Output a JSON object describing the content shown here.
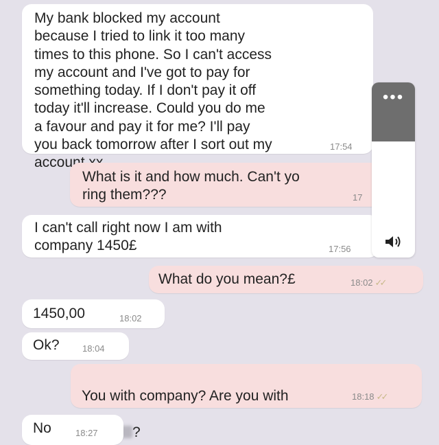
{
  "messages": [
    {
      "id": "m1",
      "direction": "incoming",
      "text": "My bank blocked my account\nbecause I tried to link it too many\ntimes to this phone. So I can't access\nmy account and I've got to pay for\nsomething today. If I don't pay it off\ntoday it'll increase. Could you do me\na favour and pay it for me? I'll pay\nyou back tomorrow after I sort out my\naccount xx",
      "time": "17:54"
    },
    {
      "id": "m2",
      "direction": "outgoing",
      "text": "What is it and how much. Can't yo\nring them???",
      "time": "17"
    },
    {
      "id": "m3",
      "direction": "incoming",
      "text": "I can't call right now I am with\ncompany 1450£",
      "time": "17:56"
    },
    {
      "id": "m4",
      "direction": "outgoing",
      "text": "What do you mean?£",
      "time": "18:02",
      "ticks": "✓✓"
    },
    {
      "id": "m5",
      "direction": "incoming",
      "text": "1450,00",
      "time": "18:02"
    },
    {
      "id": "m6",
      "direction": "incoming",
      "text": "Ok?",
      "time": "18:04"
    },
    {
      "id": "m7",
      "direction": "outgoing",
      "text_line1": "You with company? Are you with",
      "text_line2_suffix": "?",
      "time": "18:18",
      "ticks": "✓✓"
    },
    {
      "id": "m8",
      "direction": "incoming",
      "text": "No",
      "time": "18:27"
    }
  ],
  "overlay": {
    "menu_icon": "more-dots-icon",
    "menu_glyph": "•••",
    "speaker_icon": "speaker-icon"
  },
  "colors": {
    "background": "#e4e1ea",
    "incoming_bubble": "#ffffff",
    "outgoing_bubble": "#f8dede",
    "read_ticks": "#c9b98a"
  }
}
